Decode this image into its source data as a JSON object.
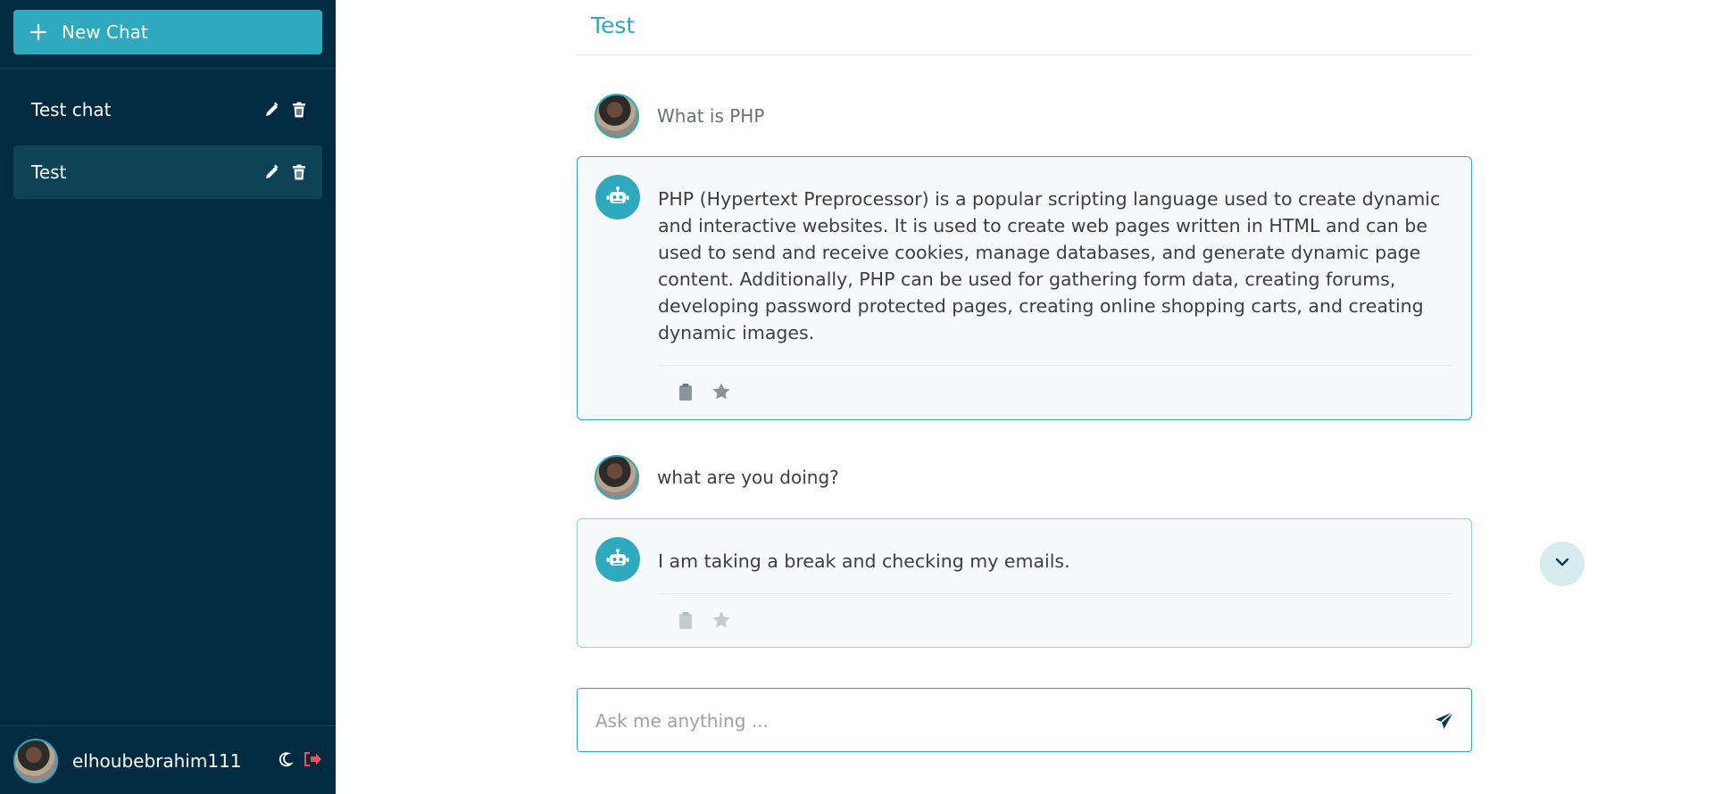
{
  "sidebar": {
    "new_chat_label": "New Chat",
    "chats": [
      {
        "label": "Test chat",
        "active": false
      },
      {
        "label": "Test",
        "active": true
      }
    ],
    "user": {
      "name": "elhoubebrahim111"
    }
  },
  "main": {
    "title": "Test",
    "messages": [
      {
        "role": "user",
        "text": "What is PHP"
      },
      {
        "role": "assistant",
        "text": "PHP (Hypertext Preprocessor) is a popular scripting language used to create dynamic and interactive websites. It is used to create web pages written in HTML and can be used to send and receive cookies, manage databases, and generate dynamic page content. Additionally, PHP can be used for gathering form data, creating forums, developing password protected pages, creating online shopping carts, and creating dynamic images."
      },
      {
        "role": "user",
        "text": "what are you doing?"
      },
      {
        "role": "assistant",
        "text": "I am taking a break and checking my emails."
      }
    ],
    "input": {
      "placeholder": "Ask me anything ...",
      "value": ""
    }
  },
  "icons": {
    "plus": "plus-icon",
    "edit": "pencil-icon",
    "delete": "trash-icon",
    "bot": "robot-icon",
    "copy": "clipboard-icon",
    "favorite": "star-icon",
    "scroll": "chevron-down-icon",
    "send": "send-icon",
    "theme": "moon-icon",
    "logout": "logout-icon"
  },
  "colors": {
    "sidebar_bg": "#022b41",
    "accent": "#2fa9bd",
    "active_item": "#0e4357",
    "logout": "#e55353"
  }
}
